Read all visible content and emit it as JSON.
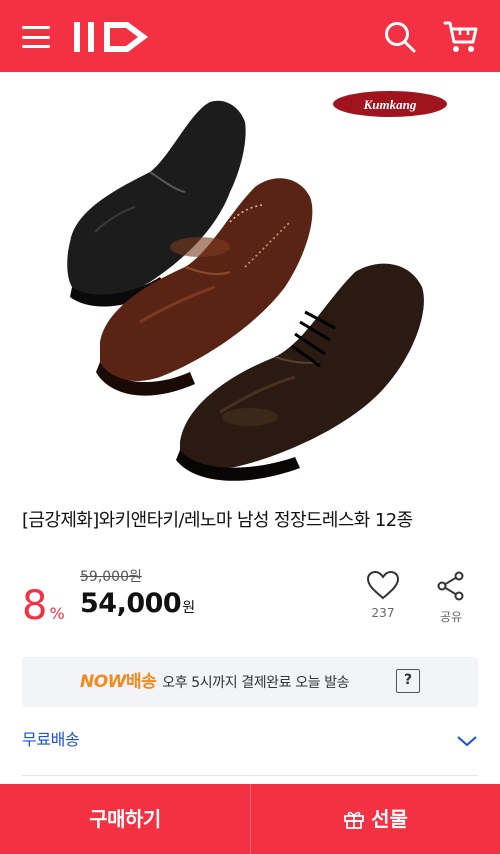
{
  "header": {
    "logo_text": "11",
    "menu_icon": "hamburger-menu-icon",
    "search_icon": "search-icon",
    "cart_icon": "cart-icon",
    "brand_color": "#f43142"
  },
  "product": {
    "brand_badge": "Kumkang",
    "title": "[금강제화]와키앤타키/레노마 남성 정장드레스화 12종",
    "discount_value": "8",
    "discount_unit": "%",
    "original_price": "59,000원",
    "sale_price": "54,000",
    "currency": "원"
  },
  "actions": {
    "like_count": "237",
    "share_label": "공유"
  },
  "delivery": {
    "now_brand_en": "NOW",
    "now_brand_kr": "배송",
    "now_text": "오후 5시까지 결제완료 오늘 발송",
    "help_label": "?",
    "shipping_label": "무료배송"
  },
  "bottom": {
    "buy_label": "구매하기",
    "gift_label": "선물"
  }
}
